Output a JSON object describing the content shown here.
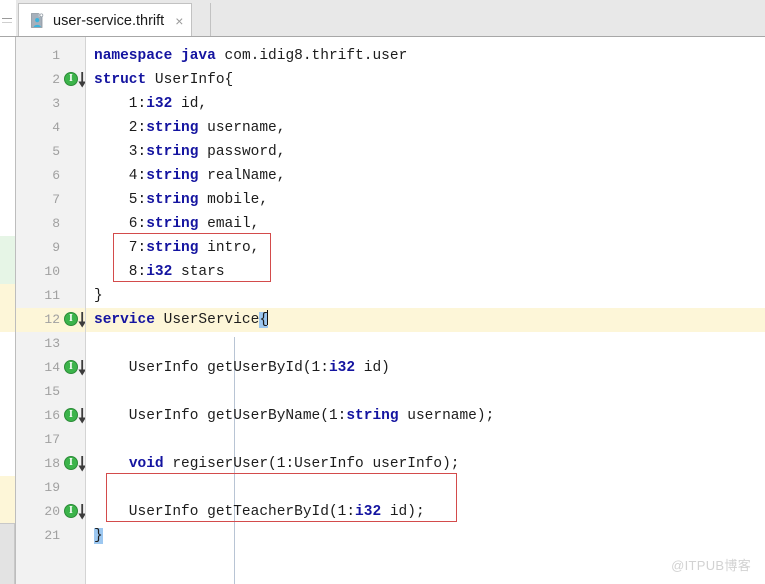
{
  "window": {
    "app": "IntelliJ IDEA editor",
    "watermark": "@ITPUB博客"
  },
  "tab": {
    "label": "user-service.thrift",
    "icon": "thrift-file-icon",
    "close_label": "×",
    "active": true
  },
  "editor": {
    "language": "thrift",
    "current_line": 12,
    "caret_line": 12,
    "caret_column": 24,
    "lines": [
      {
        "n": 1,
        "text": "namespace java com.idig8.thrift.user",
        "gutter_icon": false
      },
      {
        "n": 2,
        "text": "struct UserInfo{",
        "gutter_icon": true
      },
      {
        "n": 3,
        "text": "    1:i32 id,",
        "gutter_icon": false
      },
      {
        "n": 4,
        "text": "    2:string username,",
        "gutter_icon": false
      },
      {
        "n": 5,
        "text": "    3:string password,",
        "gutter_icon": false
      },
      {
        "n": 6,
        "text": "    4:string realName,",
        "gutter_icon": false
      },
      {
        "n": 7,
        "text": "    5:string mobile,",
        "gutter_icon": false
      },
      {
        "n": 8,
        "text": "    6:string email,",
        "gutter_icon": false
      },
      {
        "n": 9,
        "text": "    7:string intro,",
        "gutter_icon": false
      },
      {
        "n": 10,
        "text": "    8:i32 stars",
        "gutter_icon": false
      },
      {
        "n": 11,
        "text": "}",
        "gutter_icon": false
      },
      {
        "n": 12,
        "text": "service UserService{",
        "gutter_icon": true
      },
      {
        "n": 13,
        "text": "",
        "gutter_icon": false
      },
      {
        "n": 14,
        "text": "    UserInfo getUserById(1:i32 id)",
        "gutter_icon": true
      },
      {
        "n": 15,
        "text": "",
        "gutter_icon": false
      },
      {
        "n": 16,
        "text": "    UserInfo getUserByName(1:string username);",
        "gutter_icon": true
      },
      {
        "n": 17,
        "text": "",
        "gutter_icon": false
      },
      {
        "n": 18,
        "text": "    void regiserUser(1:UserInfo userInfo);",
        "gutter_icon": true
      },
      {
        "n": 19,
        "text": "",
        "gutter_icon": false
      },
      {
        "n": 20,
        "text": "    UserInfo getTeacherById(1:i32 id);",
        "gutter_icon": true
      },
      {
        "n": 21,
        "text": "}",
        "gutter_icon": false
      }
    ],
    "keywords": [
      "namespace",
      "java",
      "struct",
      "string",
      "i32",
      "service",
      "void"
    ],
    "gutter_icon_name": "implementation-marker-icon",
    "gutter_icon_lines": [
      2,
      12,
      14,
      16,
      18,
      20
    ]
  },
  "annotations": [
    {
      "name": "highlight-box-struct-fields",
      "covers_lines": [
        9,
        10
      ],
      "color": "#d34b4b"
    },
    {
      "name": "highlight-box-get-teacher",
      "covers_lines": [
        19,
        20
      ],
      "color": "#d34b4b"
    }
  ],
  "change_markers": [
    {
      "name": "added-lines-marker",
      "lines": [
        9,
        10
      ],
      "color": "#e6f5e6"
    },
    {
      "name": "modified-lines-marker",
      "lines": [
        11,
        12
      ],
      "color": "#fdf6d8"
    },
    {
      "name": "modified-lines-marker-2",
      "lines": [
        19,
        20
      ],
      "color": "#fdf6d8"
    }
  ],
  "colors": {
    "keyword": "#1414a0",
    "text": "#1c1c1c",
    "current_line_bg": "#fdf6d8",
    "gutter_bg": "#f2f2f2",
    "line_number": "#a0a0a0",
    "brace_match_bg": "#9cc7f0",
    "annotation": "#d34b4b"
  }
}
